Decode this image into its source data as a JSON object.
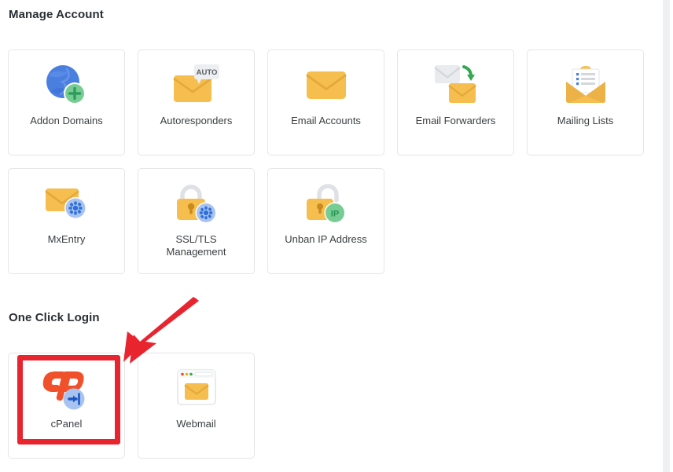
{
  "sections": [
    {
      "title": "Manage Account",
      "tiles": [
        {
          "label": "Addon Domains",
          "icon": "globe-plus-icon"
        },
        {
          "label": "Autoresponders",
          "icon": "envelope-auto-icon"
        },
        {
          "label": "Email Accounts",
          "icon": "envelope-icon"
        },
        {
          "label": "Email Forwarders",
          "icon": "envelope-forward-icon"
        },
        {
          "label": "Mailing Lists",
          "icon": "envelope-list-icon"
        },
        {
          "label": "MxEntry",
          "icon": "envelope-gear-icon"
        },
        {
          "label": "SSL/TLS\nManagement",
          "icon": "lock-gear-icon"
        },
        {
          "label": "Unban IP Address",
          "icon": "unlock-ip-icon"
        }
      ]
    },
    {
      "title": "One Click Login",
      "tiles": [
        {
          "label": "cPanel",
          "icon": "cpanel-login-icon"
        },
        {
          "label": "Webmail",
          "icon": "browser-envelope-icon"
        }
      ]
    }
  ],
  "annotation": {
    "highlight_target": "cPanel",
    "arrow_color": "#e8242f",
    "box_color": "#e8242f"
  },
  "colors": {
    "envelope_orange": "#f6be4f",
    "envelope_orange_dark": "#edad3c",
    "globe_blue": "#4a7fe0",
    "badge_green": "#76cc93",
    "badge_blue": "#a8c3f0",
    "gear_blue": "#2f6fd8",
    "cpanel_orange": "#f0512a",
    "text_dark": "#3c4043",
    "heading_dark": "#2b2f33",
    "tile_border": "#e4e6e8"
  },
  "autoresponder_badge_text": "AUTO",
  "unban_badge_text": "IP"
}
